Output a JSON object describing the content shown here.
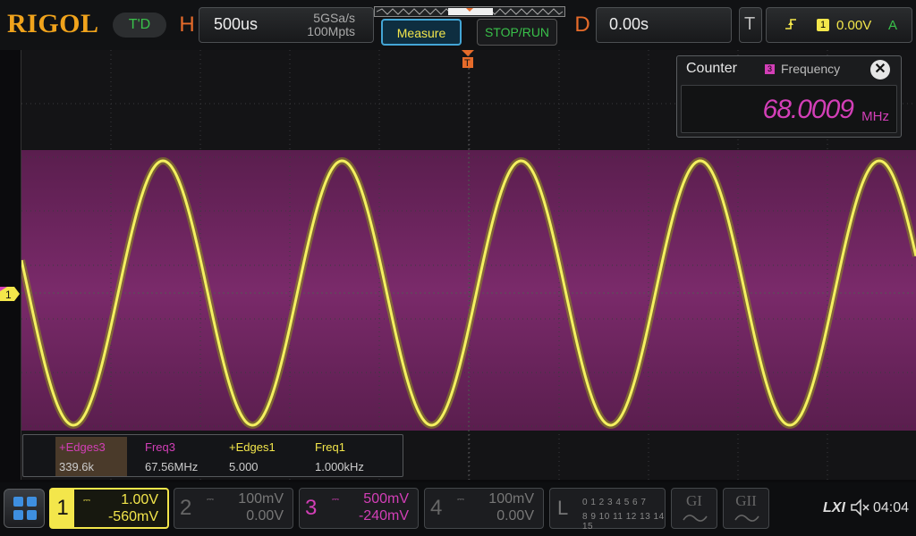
{
  "brand": {
    "logo": "RIGOL",
    "mode": "T'D"
  },
  "horizontal": {
    "letter": "H",
    "timebase": "500us",
    "sample_rate": "5GSa/s",
    "memory_depth": "100Mpts"
  },
  "toolbar": {
    "measure_label": "Measure",
    "stop_run_label": "STOP/RUN"
  },
  "delay": {
    "letter": "D",
    "value": "0.00s"
  },
  "trigger": {
    "letter": "T",
    "source": "1",
    "level": "0.00V",
    "mode": "A"
  },
  "counter": {
    "title": "Counter",
    "source_channel": "3",
    "source_label": "Frequency",
    "value": "68.0009",
    "unit": "MHz",
    "close_label": "✕"
  },
  "measurements": {
    "columns": [
      {
        "header": "+Edges3",
        "value": "339.6k",
        "color": "#d33fb7"
      },
      {
        "header": "Freq3",
        "value": "67.56MHz",
        "color": "#d33fb7"
      },
      {
        "header": "+Edges1",
        "value": "5.000",
        "color": "#f3e64b"
      },
      {
        "header": "Freq1",
        "value": "1.000kHz",
        "color": "#f3e64b"
      }
    ]
  },
  "channels": [
    {
      "number": "1",
      "scale": "1.00V",
      "offset": "-560mV",
      "active": true,
      "color": "#f3e64b"
    },
    {
      "number": "2",
      "scale": "100mV",
      "offset": "0.00V",
      "active": false,
      "color": "#777777"
    },
    {
      "number": "3",
      "scale": "500mV",
      "offset": "-240mV",
      "active": true,
      "color": "#d33fb7"
    },
    {
      "number": "4",
      "scale": "100mV",
      "offset": "0.00V",
      "active": false,
      "color": "#777777"
    }
  ],
  "logic": {
    "letter": "L",
    "row1": "0 1 2 3  4 5 6 7",
    "row2": "8 9 10 11 12 13 14 15"
  },
  "generators": [
    {
      "label": "GI"
    },
    {
      "label": "GII"
    }
  ],
  "status": {
    "lxi": "LXI",
    "time": "04:04"
  },
  "markers": {
    "ch1_marker": "1",
    "trigger_pos": "T"
  }
}
